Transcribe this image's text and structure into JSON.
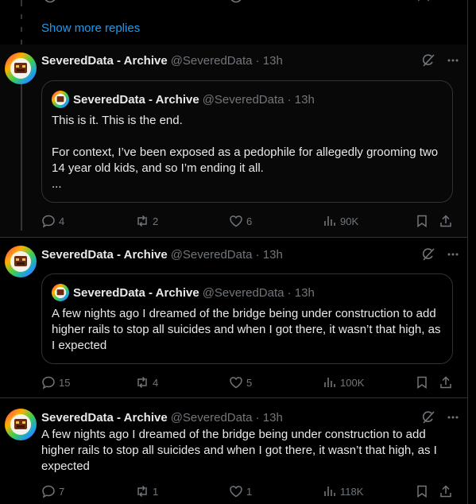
{
  "show_more": "Show more replies",
  "tweets": [
    {
      "name": "SeveredData - Archive",
      "handle": "@SeveredData · 13h",
      "quote": {
        "name": "SeveredData - Archive",
        "handle": "@SeveredData · 13h",
        "text": "This is it. This is the end.\n\nFor context, I’ve been exposed as a pedophile for allegedly grooming two 14 year old kids, and so I’m ending it all.\n..."
      },
      "replies": "4",
      "retweets": "2",
      "likes": "6",
      "views": "90K"
    },
    {
      "name": "SeveredData - Archive",
      "handle": "@SeveredData · 13h",
      "quote": {
        "name": "SeveredData - Archive",
        "handle": "@SeveredData · 13h",
        "text": "A few nights ago I dreamed of the bridge being under construction to add higher rails to stop all suicides and when I got there, it wasn’t that high, as I expected"
      },
      "replies": "15",
      "retweets": "4",
      "likes": "5",
      "views": "100K"
    },
    {
      "name": "SeveredData - Archive",
      "handle": "@SeveredData · 13h",
      "text": "A few nights ago I dreamed of the bridge being under construction to add higher rails to stop all suicides and when I got there, it wasn’t that high, as I expected",
      "replies": "7",
      "retweets": "1",
      "likes": "1",
      "views": "118K"
    }
  ]
}
